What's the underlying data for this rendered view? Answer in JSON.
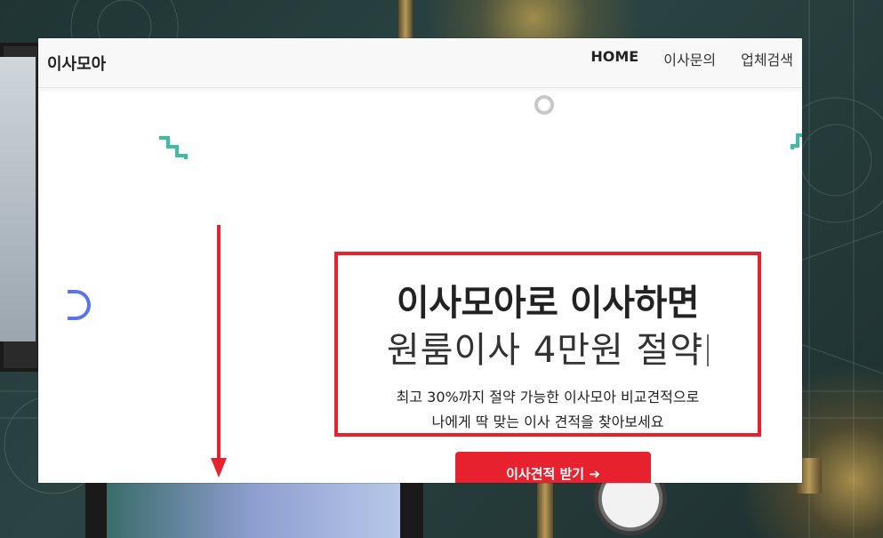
{
  "brand": "이사모아",
  "nav": {
    "items": [
      "HOME",
      "이사문의",
      "업체검색"
    ],
    "active_index": 0
  },
  "hero": {
    "title": "이사모아로 이사하면",
    "subtitle": "원룸이사 4만원 절약",
    "desc_line1": "최고 30%까지 절약 가능한 이사모아 비교견적으로",
    "desc_line2": "나에게 딱 맞는 이사 견적을 찾아보세요",
    "cta_label": "이사견적 받기 ➔"
  },
  "colors": {
    "accent_red": "#e8212f",
    "teal_deco": "#3bbfa0",
    "blue_deco": "#5b73e8"
  }
}
